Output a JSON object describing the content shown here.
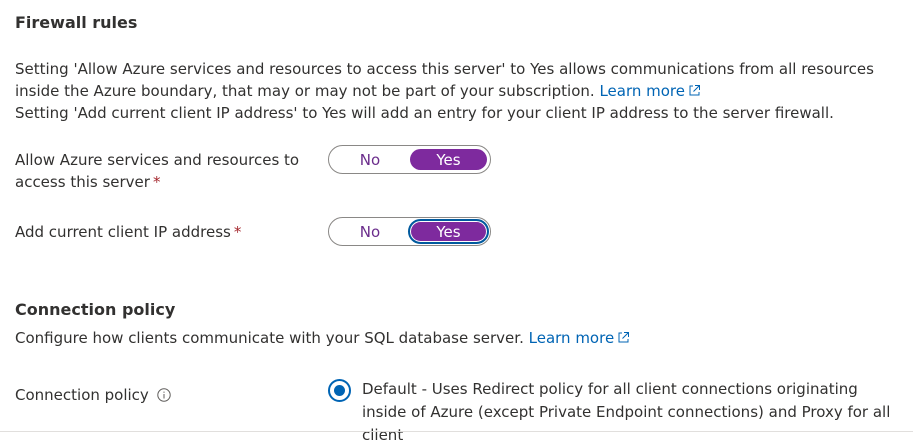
{
  "firewall": {
    "title": "Firewall rules",
    "desc_line1": "Setting 'Allow Azure services and resources to access this server' to Yes allows communications from all resources inside the Azure boundary, that may or may not be part of your subscription.",
    "learn_more": "Learn more",
    "desc_line2": "Setting 'Add current client IP address' to Yes will add an entry for your client IP address to the server firewall.",
    "allow_azure": {
      "label": "Allow Azure services and resources to access this server",
      "required_mark": "*",
      "no": "No",
      "yes": "Yes",
      "selected": "Yes"
    },
    "add_client_ip": {
      "label": "Add current client IP address",
      "required_mark": "*",
      "no": "No",
      "yes": "Yes",
      "selected": "Yes"
    }
  },
  "connection": {
    "title": "Connection policy",
    "desc": "Configure how clients communicate with your SQL database server.",
    "learn_more": "Learn more",
    "policy_label": "Connection policy",
    "option_default": "Default - Uses Redirect policy for all client connections originating inside of Azure (except Private Endpoint connections) and Proxy for all client"
  },
  "colors": {
    "accent_purple": "#7e2a9e",
    "link_blue": "#0064b4",
    "required_red": "#a4262c"
  },
  "icons": {
    "external_link": "external-link-icon",
    "info": "info-icon"
  }
}
